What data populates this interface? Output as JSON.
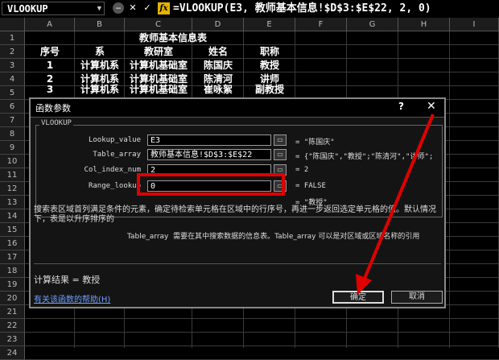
{
  "formula_bar": {
    "name_box": "VLOOKUP",
    "cancel_glyph": "✕",
    "enter_glyph": "✓",
    "fx_label": "fx",
    "formula": "=VLOOKUP(E3, 教师基本信息!$D$3:$E$22, 2, 0)"
  },
  "columns": [
    "A",
    "B",
    "C",
    "D",
    "E",
    "F",
    "G",
    "H",
    "I"
  ],
  "rows": [
    "1",
    "2",
    "3",
    "4",
    "5",
    "6",
    "7",
    "8",
    "9",
    "10",
    "11",
    "12",
    "13",
    "14",
    "15",
    "16",
    "17",
    "18",
    "19",
    "20",
    "21",
    "22",
    "23",
    "24"
  ],
  "sheet": {
    "title": "教师基本信息表",
    "headers": [
      "序号",
      "系",
      "教研室",
      "姓名",
      "职称"
    ],
    "data_rows": [
      [
        "1",
        "计算机系",
        "计算机基础室",
        "陈国庆",
        "教授"
      ],
      [
        "2",
        "计算机系",
        "计算机基础室",
        "陈清河",
        "讲师"
      ],
      [
        "3",
        "计算机系",
        "计算机基础室",
        "崔咏絮",
        "副教授"
      ]
    ]
  },
  "dialog": {
    "title": "函数参数",
    "help_glyph": "?",
    "close_glyph": "✕",
    "group_label": "VLOOKUP",
    "params": [
      {
        "label": "Lookup_value",
        "value": "E3",
        "result": "= \"陈国庆\""
      },
      {
        "label": "Table_array",
        "value": "教师基本信息!$D$3:$E$22",
        "result": "= {\"陈国庆\",\"教授\";\"陈清河\",\"讲师\";"
      },
      {
        "label": "Col_index_num",
        "value": "2",
        "result": "= 2"
      },
      {
        "label": "Range_lookup",
        "value": "0",
        "result": "= FALSE"
      }
    ],
    "overall_result": "= \"教授\"",
    "description": "搜索表区域首列满足条件的元素，确定待检索单元格在区域中的行序号，再进一步返回选定单元格的值。默认情况下，表是以升序排序的",
    "param_name": "Table_array",
    "param_description": "需要在其中搜索数据的信息表。Table_array 可以是对区域或区域名称的引用",
    "calc_result": "计算结果 = 教授",
    "help_link": "有关该函数的帮助(H)",
    "ok_label": "确定",
    "cancel_label": "取消"
  },
  "colors": {
    "highlight": "#e00000",
    "fx": "#e6b400",
    "link": "#6f9fff"
  }
}
